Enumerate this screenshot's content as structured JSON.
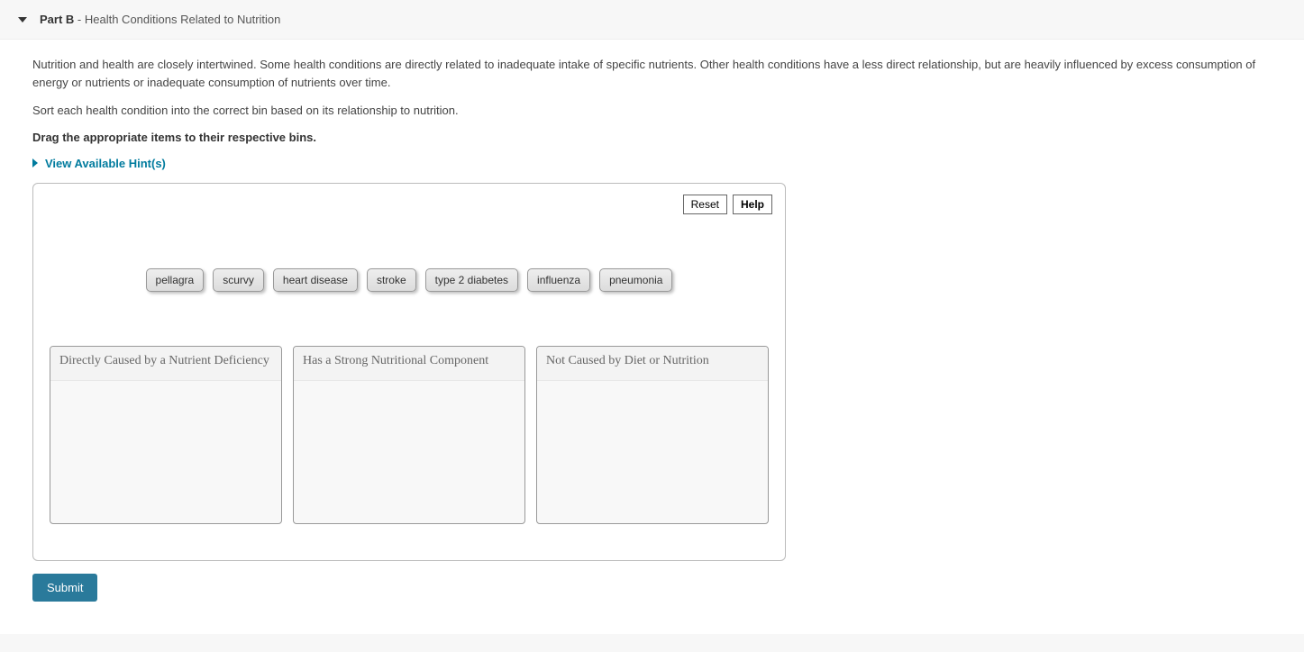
{
  "header": {
    "part_label": "Part B",
    "separator": " - ",
    "part_title": "Health Conditions Related to Nutrition"
  },
  "intro": {
    "p1": "Nutrition and health are closely intertwined. Some health conditions are directly related to inadequate intake of specific nutrients. Other health conditions have a less direct relationship, but are heavily influenced by excess consumption of energy or nutrients or inadequate consumption of nutrients over time.",
    "p2": "Sort each health condition into the correct bin based on its relationship to nutrition.",
    "bold_instruction": "Drag the appropriate items to their respective bins."
  },
  "hints_label": "View Available Hint(s)",
  "controls": {
    "reset": "Reset",
    "help": "Help"
  },
  "drag_items": [
    "pellagra",
    "scurvy",
    "heart disease",
    "stroke",
    "type 2 diabetes",
    "influenza",
    "pneumonia"
  ],
  "bins": [
    "Directly Caused by a Nutrient Deficiency",
    "Has a Strong Nutritional Component",
    "Not Caused by Diet or Nutrition"
  ],
  "submit_label": "Submit"
}
